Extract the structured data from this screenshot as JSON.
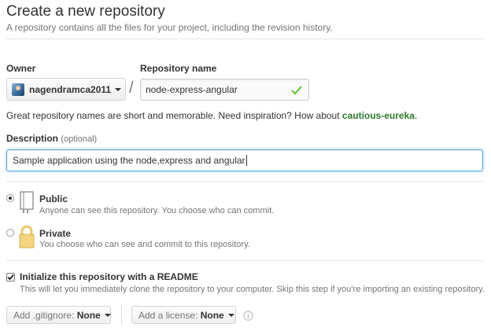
{
  "header": {
    "title": "Create a new repository",
    "subtitle": "A repository contains all the files for your project, including the revision history."
  },
  "owner": {
    "label": "Owner",
    "value": "nagendramca2011"
  },
  "separator": "/",
  "repo_name": {
    "label": "Repository name",
    "value": "node-express-angular"
  },
  "suggestion": {
    "text": "Great repository names are short and memorable. Need inspiration? How about ",
    "name": "cautious-eureka",
    "end": "."
  },
  "description": {
    "label": "Description",
    "optional": "(optional)",
    "value": "Sample application using the node,express and angular"
  },
  "visibility": {
    "selected": "public",
    "public": {
      "label": "Public",
      "desc": "Anyone can see this repository. You choose who can commit."
    },
    "private": {
      "label": "Private",
      "desc": "You choose who can see and commit to this repository."
    }
  },
  "readme": {
    "checked": true,
    "label": "Initialize this repository with a README",
    "desc": "This will let you immediately clone the repository to your computer. Skip this step if you’re importing an existing repository."
  },
  "gitignore": {
    "prefix": "Add .gitignore:",
    "value": "None"
  },
  "license": {
    "prefix": "Add a license:",
    "value": "None"
  },
  "colors": {
    "suggestion": "#2d7a2d",
    "check": "#6cc644",
    "focus": "#51a7e8"
  }
}
